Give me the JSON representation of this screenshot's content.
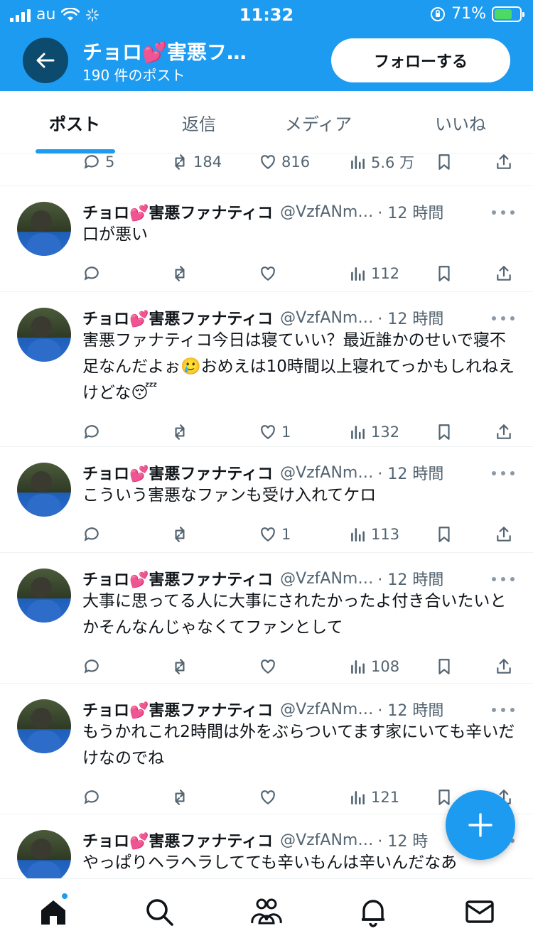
{
  "status_bar": {
    "carrier": "au",
    "time": "11:32",
    "battery": "71%",
    "battery_level": 0.71
  },
  "profile": {
    "name": "チョロ💕害悪フ…",
    "post_count": "190 件のポスト",
    "follow_label": "フォローする"
  },
  "tabs": [
    {
      "label": "ポスト",
      "active": true
    },
    {
      "label": "返信"
    },
    {
      "label": "メディア"
    },
    {
      "label": "いいね"
    }
  ],
  "top_actions": {
    "replies": "5",
    "reposts": "184",
    "likes": "816",
    "views": "5.6 万"
  },
  "posts": [
    {
      "name": "チョロ💕害悪ファナティコ",
      "handle": "@VzfANm…",
      "time": "· 12 時間",
      "text": "口が悪い",
      "replies": "",
      "reposts": "",
      "likes": "",
      "views": "112"
    },
    {
      "name": "チョロ💕害悪ファナティコ",
      "handle": "@VzfANm…",
      "time": "· 12 時間",
      "text": "害悪ファナティコ今日は寝ていい？最近誰かのせいで寝不足なんだよぉ🥲おめえは10時間以上寝れてっかもしれねえけどな😴",
      "replies": "",
      "reposts": "",
      "likes": "1",
      "views": "132"
    },
    {
      "name": "チョロ💕害悪ファナティコ",
      "handle": "@VzfANm…",
      "time": "· 12 時間",
      "text": "こういう害悪なファンも受け入れてケロ",
      "replies": "",
      "reposts": "",
      "likes": "1",
      "views": "113"
    },
    {
      "name": "チョロ💕害悪ファナティコ",
      "handle": "@VzfANm…",
      "time": "· 12 時間",
      "text": "大事に思ってる人に大事にされたかったよ付き合いたいとかそんなんじゃなくてファンとして",
      "replies": "",
      "reposts": "",
      "likes": "",
      "views": "108"
    },
    {
      "name": "チョロ💕害悪ファナティコ",
      "handle": "@VzfANm…",
      "time": "· 12 時間",
      "text": "もうかれこれ2時間は外をぶらついてます家にいても辛いだけなのでね",
      "replies": "",
      "reposts": "",
      "likes": "",
      "views": "121"
    },
    {
      "name": "チョロ💕害悪ファナティコ",
      "handle": "@VzfANm…",
      "time": "· 12 時",
      "text": "やっぱりヘラヘラしてても辛いもんは辛いんだなあ",
      "replies": "",
      "reposts": "",
      "likes": "",
      "views": ""
    }
  ],
  "colors": {
    "accent": "#1d9bf0",
    "text": "#0f1419",
    "secondary": "#536471"
  },
  "bottom_nav": [
    {
      "icon": "home-icon",
      "badge": true
    },
    {
      "icon": "search-icon"
    },
    {
      "icon": "communities-icon"
    },
    {
      "icon": "notifications-icon"
    },
    {
      "icon": "messages-icon"
    }
  ]
}
